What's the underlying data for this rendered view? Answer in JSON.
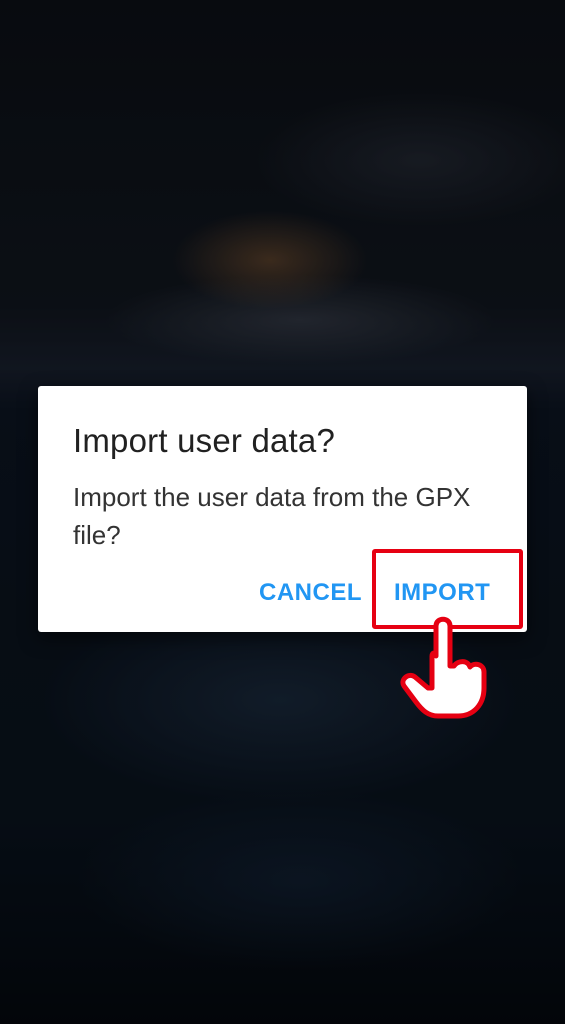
{
  "dialog": {
    "title": "Import user data?",
    "message": "Import the user data from the GPX file?",
    "cancel_label": "CANCEL",
    "import_label": "IMPORT"
  },
  "colors": {
    "accent": "#2196f3",
    "highlight": "#e60012",
    "dialog_bg": "#ffffff",
    "title": "#212121"
  },
  "annotation": {
    "highlight_target": "import-button",
    "pointer_icon": "pointing-hand-icon"
  }
}
